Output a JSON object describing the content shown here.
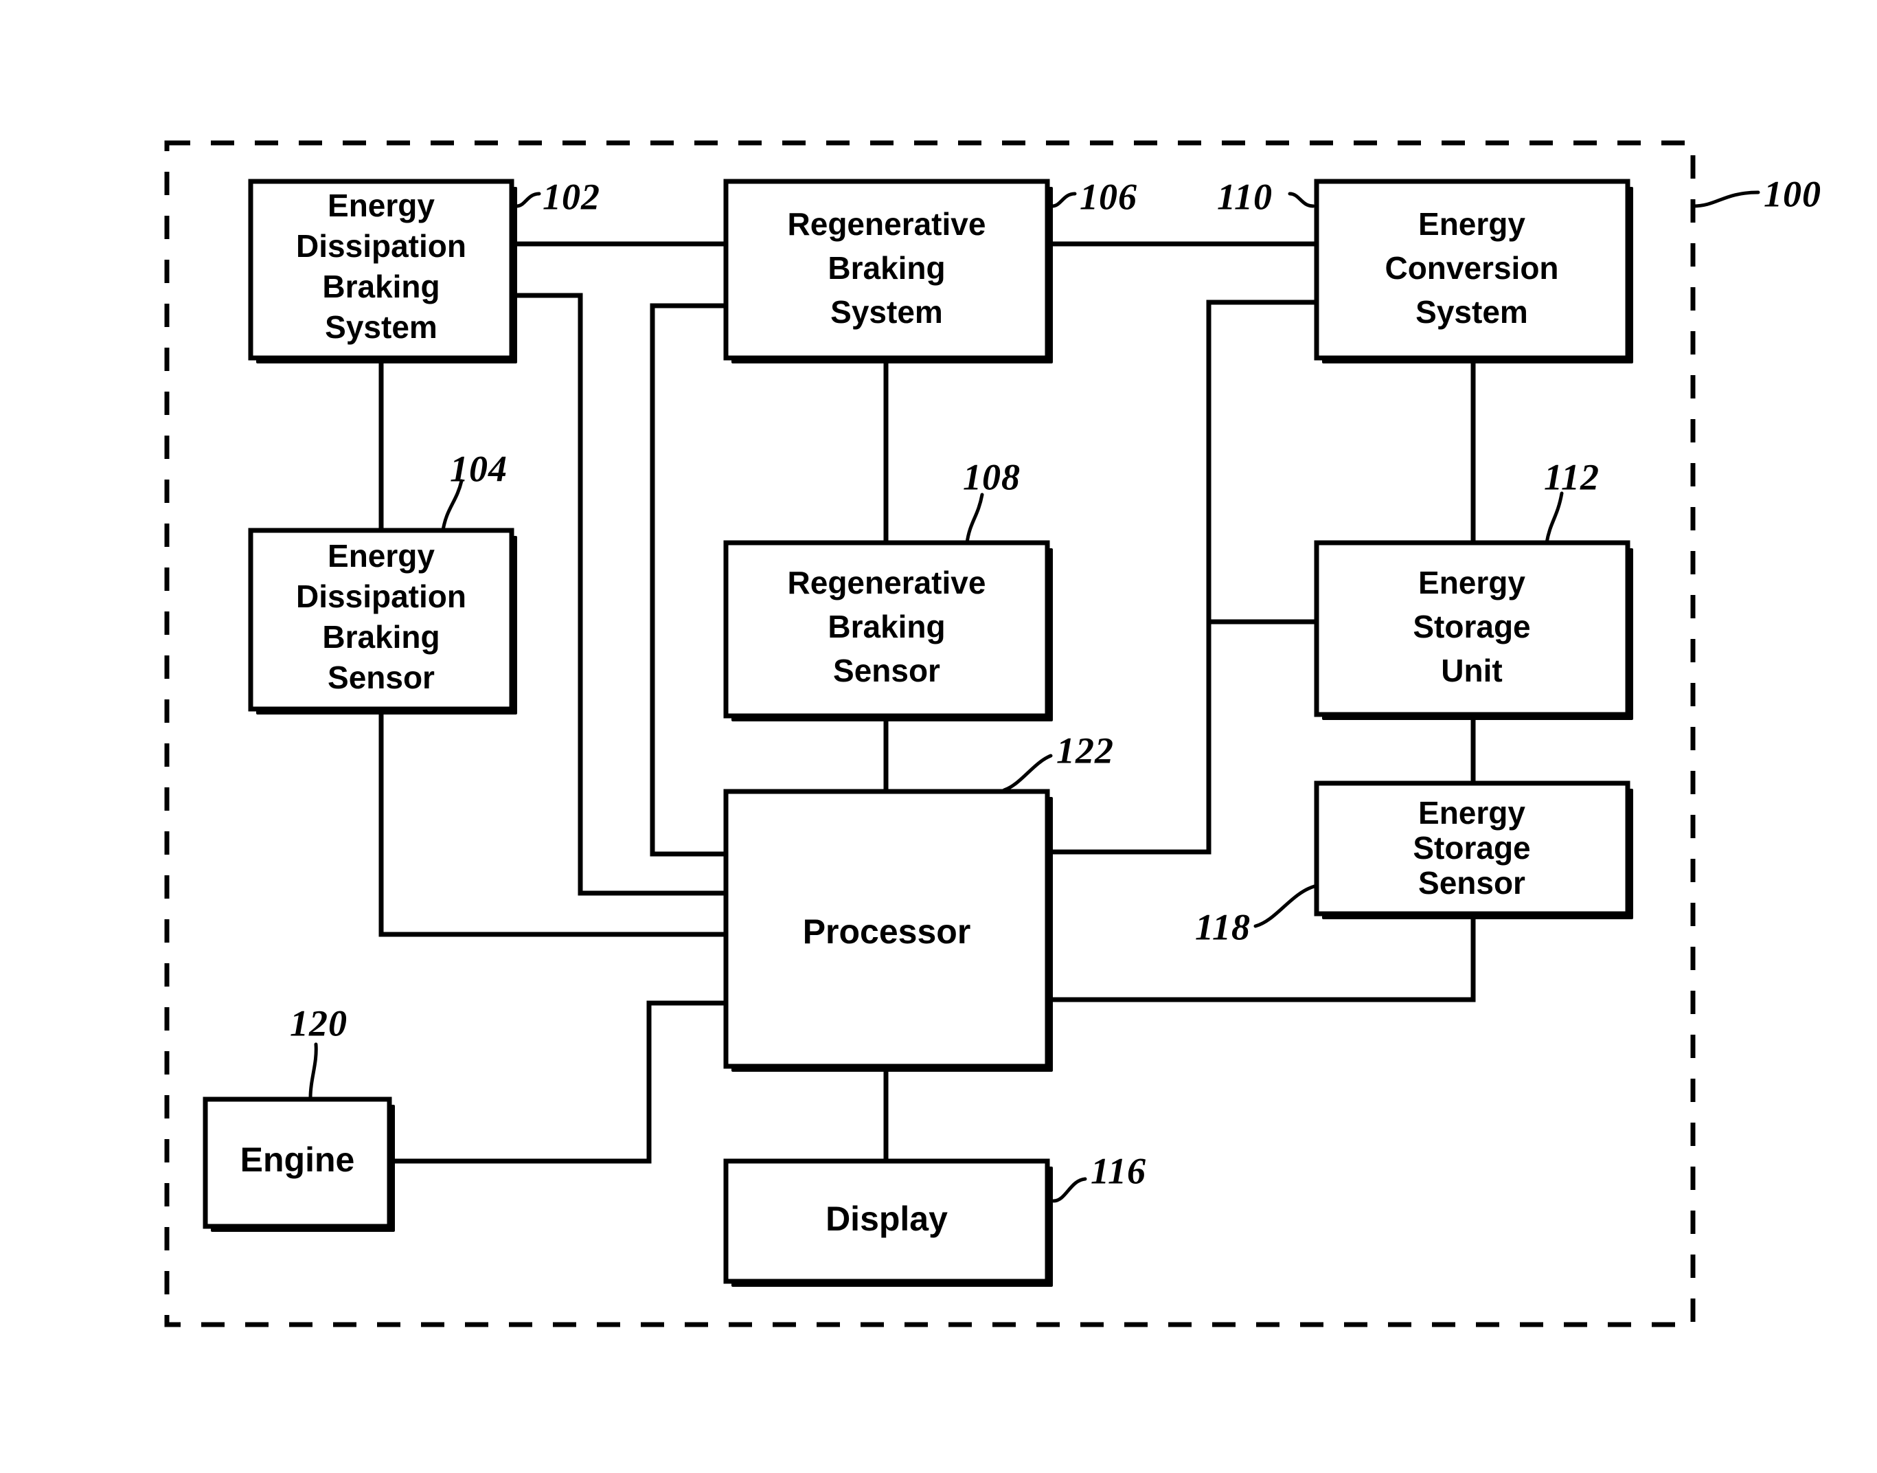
{
  "figure": {
    "enclosure_ref": "100",
    "boxes": [
      {
        "id": "energy-dissipation-braking-system",
        "ref": "102",
        "lines": [
          "Energy",
          "Dissipation",
          "Braking",
          "System"
        ]
      },
      {
        "id": "energy-dissipation-braking-sensor",
        "ref": "104",
        "lines": [
          "Energy",
          "Dissipation",
          "Braking",
          "Sensor"
        ]
      },
      {
        "id": "regenerative-braking-system",
        "ref": "106",
        "lines": [
          "Regenerative",
          "Braking",
          "System"
        ]
      },
      {
        "id": "regenerative-braking-sensor",
        "ref": "108",
        "lines": [
          "Regenerative",
          "Braking",
          "Sensor"
        ]
      },
      {
        "id": "energy-conversion-system",
        "ref": "110",
        "lines": [
          "Energy",
          "Conversion",
          "System"
        ]
      },
      {
        "id": "energy-storage-unit",
        "ref": "112",
        "lines": [
          "Energy",
          "Storage",
          "Unit"
        ]
      },
      {
        "id": "energy-storage-sensor",
        "ref": "118",
        "lines": [
          "Energy",
          "Storage",
          "Sensor"
        ]
      },
      {
        "id": "processor",
        "ref": "122",
        "lines": [
          "Processor"
        ]
      },
      {
        "id": "display",
        "ref": "116",
        "lines": [
          "Display"
        ]
      },
      {
        "id": "engine",
        "ref": "120",
        "lines": [
          "Engine"
        ]
      }
    ],
    "ref_numerals": [
      "100",
      "102",
      "104",
      "106",
      "108",
      "110",
      "112",
      "116",
      "118",
      "120",
      "122"
    ],
    "colors": {
      "line": "#000000",
      "background": "#ffffff",
      "text": "#000000"
    }
  }
}
